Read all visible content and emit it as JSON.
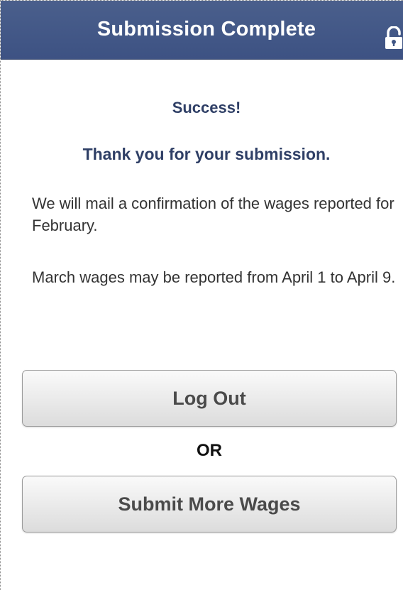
{
  "header": {
    "title": "Submission Complete",
    "lock_icon": "unlocked-padlock-icon",
    "background_color": "#3f5585"
  },
  "content": {
    "success": "Success!",
    "thanks": "Thank you for your submission.",
    "confirmation": "We will mail a confirmation of the wages reported for February.",
    "next_period": "March wages may be reported from April 1 to April 9."
  },
  "actions": {
    "logout_label": "Log Out",
    "or_label": "OR",
    "submit_more_label": "Submit More Wages"
  },
  "colors": {
    "heading_text": "#2f3f66",
    "body_text": "#333333",
    "button_text": "#4a4a4a"
  }
}
